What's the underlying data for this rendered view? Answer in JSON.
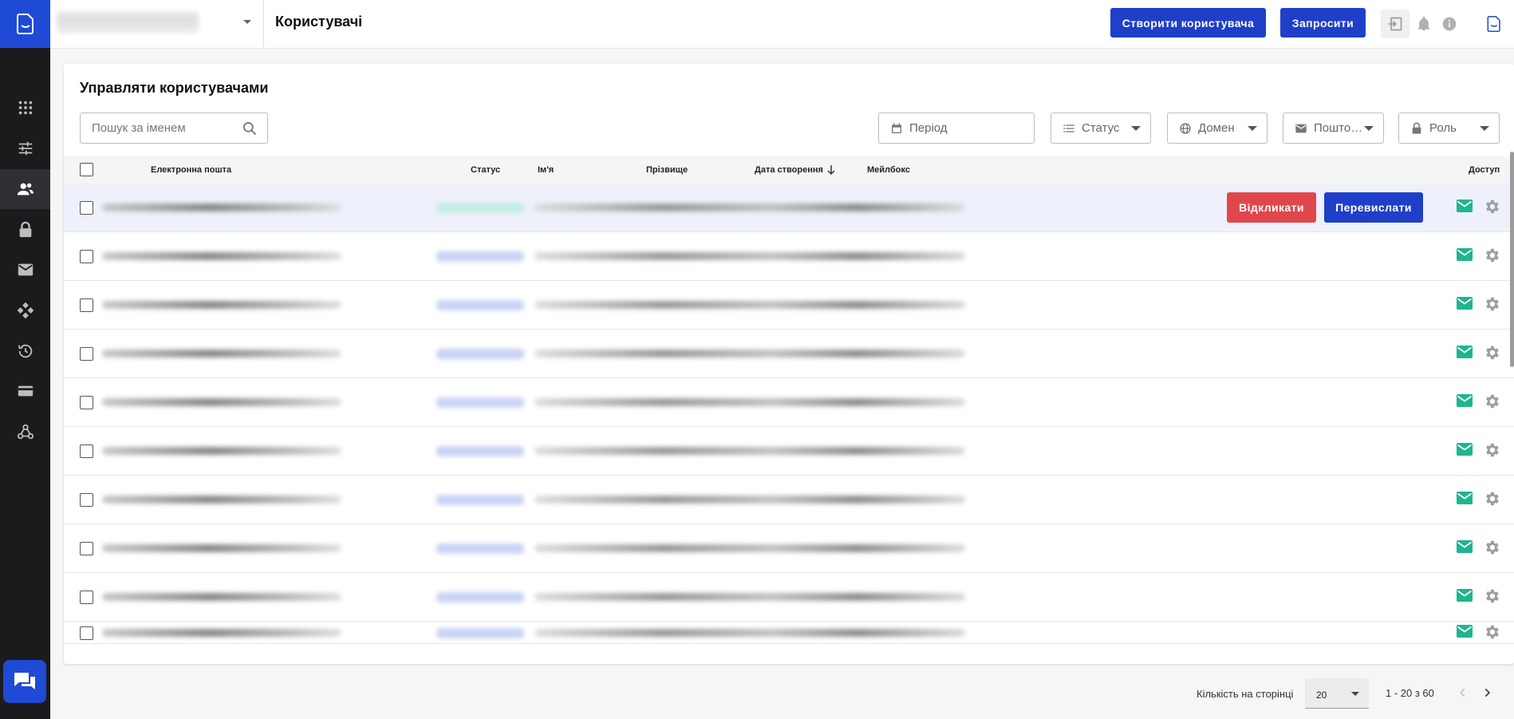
{
  "header": {
    "page_title": "Користувачі",
    "create_user_label": "Створити користувача",
    "invite_label": "Запросити"
  },
  "main": {
    "title": "Управляти користувачами",
    "search_placeholder": "Пошук за іменем",
    "filters": {
      "period": "Період",
      "status": "Статус",
      "domain": "Домен",
      "mail": "Пошто…",
      "role": "Роль"
    },
    "columns": {
      "email": "Електронна пошта",
      "status": "Статус",
      "first_name": "Ім'я",
      "last_name": "Прізвище",
      "created": "Дата створення",
      "mailbox": "Мейлбокс",
      "access": "Доступ"
    },
    "row_actions": {
      "revoke_label": "Відкликати",
      "resend_label": "Перевислати"
    }
  },
  "footer": {
    "per_page_label": "Кількість на сторінці",
    "per_page_value": "20",
    "range": "1 - 20 з 60"
  },
  "colors": {
    "primary": "#1f3fc9",
    "danger": "#e0474d",
    "mail_green": "#1fb58f",
    "sidebar": "#1b1b1d"
  }
}
